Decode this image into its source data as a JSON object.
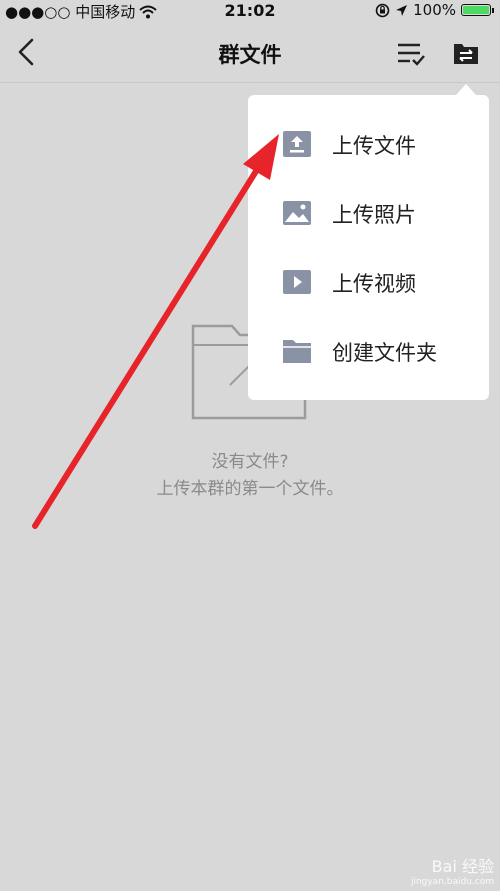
{
  "status_bar": {
    "carrier": "●●●○○ 中国移动",
    "time": "21:02",
    "battery": "100%"
  },
  "nav": {
    "title": "群文件"
  },
  "empty_state": {
    "title": "没有文件?",
    "subtitle": "上传本群的第一个文件。"
  },
  "popup_menu": {
    "items": [
      {
        "label": "上传文件",
        "icon": "upload-file-icon"
      },
      {
        "label": "上传照片",
        "icon": "image-icon"
      },
      {
        "label": "上传视频",
        "icon": "video-play-icon"
      },
      {
        "label": "创建文件夹",
        "icon": "folder-icon"
      }
    ]
  },
  "colors": {
    "background": "#d8d8d8",
    "icon_gray": "#8a93a6",
    "arrow_red": "#e8242b",
    "battery_green": "#4cd964"
  },
  "watermark": {
    "text": "Bai 经验",
    "url": "jingyan.baidu.com"
  }
}
